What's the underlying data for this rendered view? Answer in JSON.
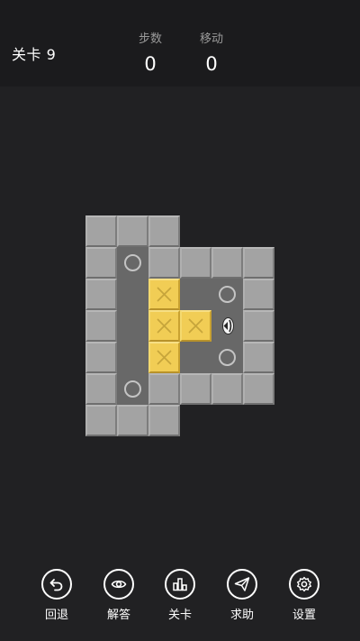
{
  "header": {
    "level_label": "关卡 9",
    "steps_label": "步数",
    "steps_value": "0",
    "moves_label": "移动",
    "moves_value": "0"
  },
  "board": {
    "cols": 6,
    "rows": 7,
    "grid": [
      "WWW   ",
      "WGWWWW",
      "WFBFGW",
      "WFBBPW",
      "WFBFGW",
      "WGWWWW",
      "WWW   "
    ],
    "legend": {
      "W": "wall",
      "F": "floor",
      "G": "goal",
      "B": "box",
      "P": "player"
    },
    "player_facing": "left"
  },
  "toolbar": {
    "items": [
      {
        "label": "回退",
        "icon": "undo-icon"
      },
      {
        "label": "解答",
        "icon": "eye-icon"
      },
      {
        "label": "关卡",
        "icon": "levels-icon"
      },
      {
        "label": "求助",
        "icon": "paper-plane-icon"
      },
      {
        "label": "设置",
        "icon": "gear-icon"
      }
    ]
  },
  "colors": {
    "background": "#212123",
    "header": "#1b1b1d",
    "wall": "#a3a3a3",
    "floor": "#686868",
    "box": "#f1cd55",
    "box_mark": "#c7a53c",
    "goal_ring": "#c4c4c4"
  }
}
